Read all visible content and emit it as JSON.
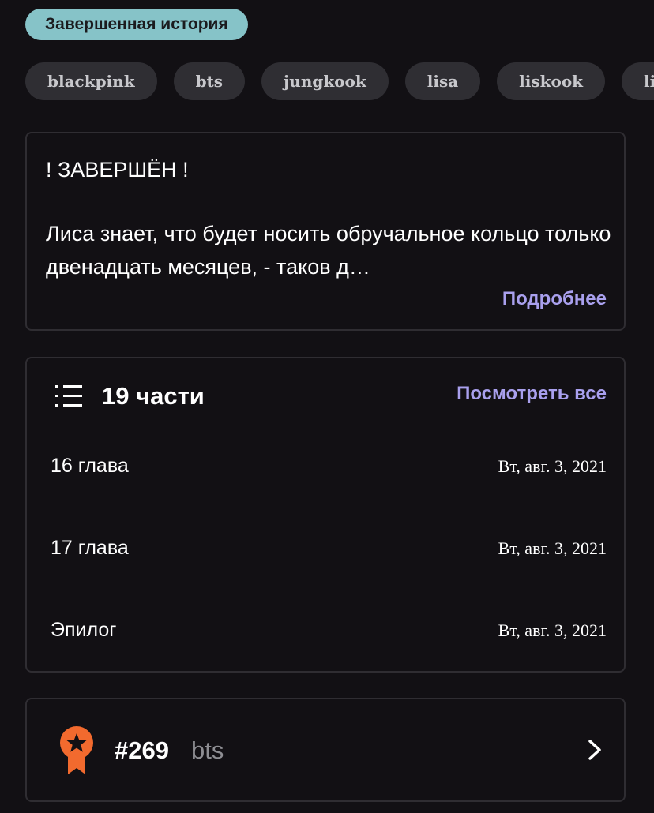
{
  "status": {
    "label": "Завершенная история"
  },
  "tags": [
    "blackpink",
    "bts",
    "jungkook",
    "lisa",
    "liskook",
    "lizkook"
  ],
  "description": {
    "heading": "! ЗАВЕРШЁН !",
    "body": "Лиса знает, что будет носить обручальное кольцо только двенадцать месяцев, - таков д…",
    "more_label": "Подробнее"
  },
  "parts": {
    "count_label": "19 части",
    "view_all_label": "Посмотреть все",
    "items": [
      {
        "title": "16 глава",
        "date": "Вт, авг. 3, 2021"
      },
      {
        "title": "17 глава",
        "date": "Вт, авг. 3, 2021"
      },
      {
        "title": "Эпилог",
        "date": "Вт, авг. 3, 2021"
      }
    ]
  },
  "ranking": {
    "rank": "#269",
    "tag": "bts"
  },
  "colors": {
    "background": "#121014",
    "accent": "#a9a0ee",
    "status_badge": "#86c3c8",
    "tag_background": "#2f2e33",
    "ribbon": "#f26a2e"
  },
  "icons": {
    "list": "list-icon",
    "ribbon": "ranking-ribbon-icon",
    "chevron": "chevron-right-icon"
  }
}
